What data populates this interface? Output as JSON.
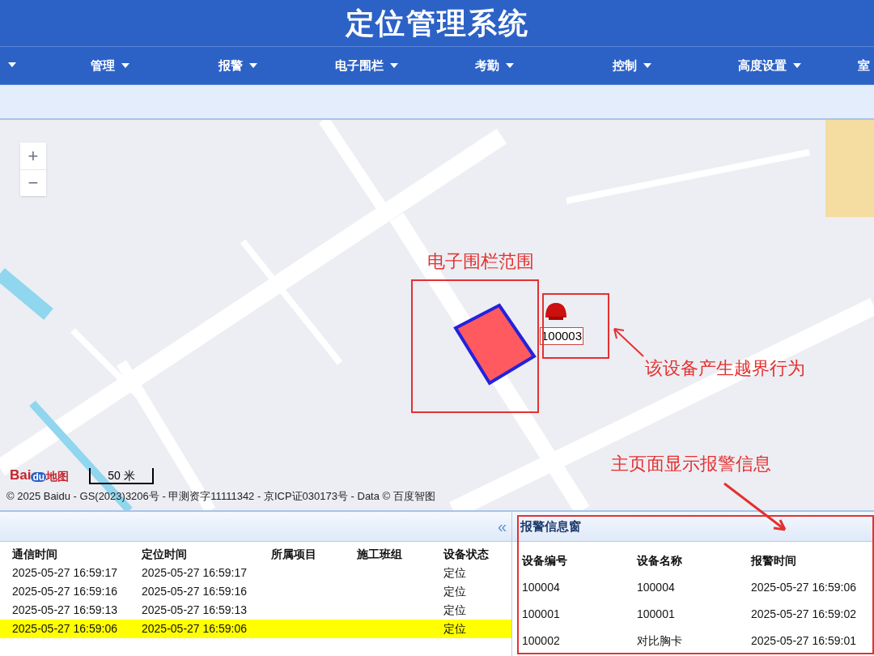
{
  "header": {
    "title": "定位管理系统"
  },
  "nav": [
    {
      "label": "管理"
    },
    {
      "label": "报警"
    },
    {
      "label": "电子围栏"
    },
    {
      "label": "考勤"
    },
    {
      "label": "控制"
    },
    {
      "label": "高度设置"
    },
    {
      "label": "室"
    }
  ],
  "map": {
    "zoom_in": "+",
    "zoom_out": "−",
    "logo_a": "Bai",
    "logo_b": "du",
    "logo_c": "地图",
    "scale": "50 米",
    "copyright": "© 2025 Baidu - GS(2023)3206号 - 甲测资字11111342 - 京ICP证030173号 - Data © 百度智图",
    "device_marker": {
      "label": "100003"
    }
  },
  "annotations": {
    "fence_note": "电子围栏范围",
    "device_note": "该设备产生越界行为",
    "alarm_note": "主页面显示报警信息"
  },
  "device_table": {
    "collapse": "«",
    "columns": [
      "通信时间",
      "定位时间",
      "所属项目",
      "施工班组",
      "设备状态"
    ],
    "rows": [
      {
        "cells": [
          "2025-05-27 16:59:17",
          "2025-05-27 16:59:17",
          "",
          "",
          "定位"
        ],
        "selected": false
      },
      {
        "cells": [
          "2025-05-27 16:59:16",
          "2025-05-27 16:59:16",
          "",
          "",
          "定位"
        ],
        "selected": false
      },
      {
        "cells": [
          "2025-05-27 16:59:13",
          "2025-05-27 16:59:13",
          "",
          "",
          "定位"
        ],
        "selected": false
      },
      {
        "cells": [
          "2025-05-27 16:59:06",
          "2025-05-27 16:59:06",
          "",
          "",
          "定位"
        ],
        "selected": true
      }
    ]
  },
  "alarm_panel": {
    "title": "报警信息窗",
    "columns": [
      "设备编号",
      "设备名称",
      "报警时间"
    ],
    "rows": [
      [
        "100004",
        "100004",
        "2025-05-27 16:59:06"
      ],
      [
        "100001",
        "100001",
        "2025-05-27 16:59:02"
      ],
      [
        "100002",
        "对比胸卡",
        "2025-05-27 16:59:01"
      ]
    ]
  }
}
